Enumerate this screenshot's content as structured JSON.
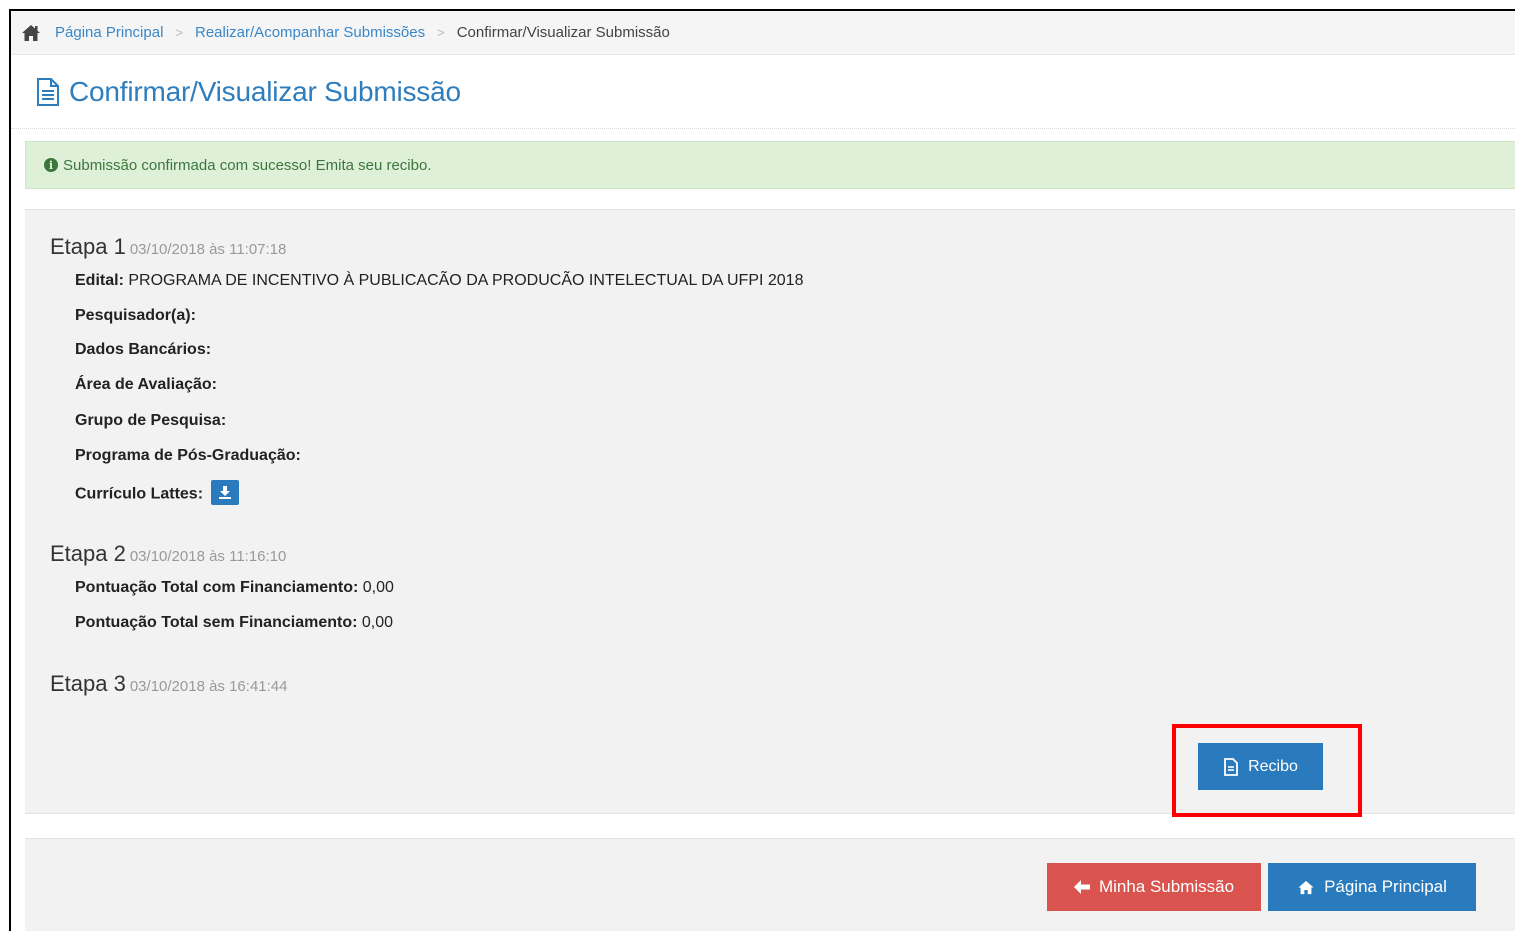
{
  "breadcrumb": {
    "home_label": "Página Principal",
    "middle_label": "Realizar/Acompanhar Submissões",
    "current_label": "Confirmar/Visualizar Submissão"
  },
  "page": {
    "title": "Confirmar/Visualizar Submissão"
  },
  "alert": {
    "message": "Submissão confirmada com sucesso! Emita seu recibo."
  },
  "etapas": [
    {
      "name": "Etapa 1",
      "date": "03/10/2018 às 11:07:18",
      "fields": [
        {
          "label": "Edital:",
          "value": "PROGRAMA DE INCENTIVO À PUBLICACÃO DA PRODUCÃO INTELECTUAL DA UFPI 2018"
        },
        {
          "label": "Pesquisador(a):",
          "value": ""
        },
        {
          "label": "Dados Bancários:",
          "value": ""
        },
        {
          "label": "Área de Avaliação:",
          "value": ""
        },
        {
          "label": "Grupo de Pesquisa:",
          "value": ""
        },
        {
          "label": "Programa de Pós-Graduação:",
          "value": ""
        },
        {
          "label": "Currículo Lattes:",
          "value": ""
        }
      ]
    },
    {
      "name": "Etapa 2",
      "date": "03/10/2018 às 11:16:10",
      "fields": [
        {
          "label": "Pontuação Total com Financiamento:",
          "value": "0,00"
        },
        {
          "label": "Pontuação Total sem Financiamento:",
          "value": "0,00"
        }
      ]
    },
    {
      "name": "Etapa 3",
      "date": "03/10/2018 às 16:41:44",
      "fields": []
    }
  ],
  "buttons": {
    "recibo": "Recibo",
    "minha_submissao": "Minha Submissão",
    "pagina_principal": "Página Principal"
  },
  "colors": {
    "link": "#3a87c8",
    "primary": "#2a7bbd",
    "danger": "#d9534f",
    "success_bg": "#dff0d8",
    "success_text": "#3c763d",
    "highlight": "#ff0000"
  }
}
